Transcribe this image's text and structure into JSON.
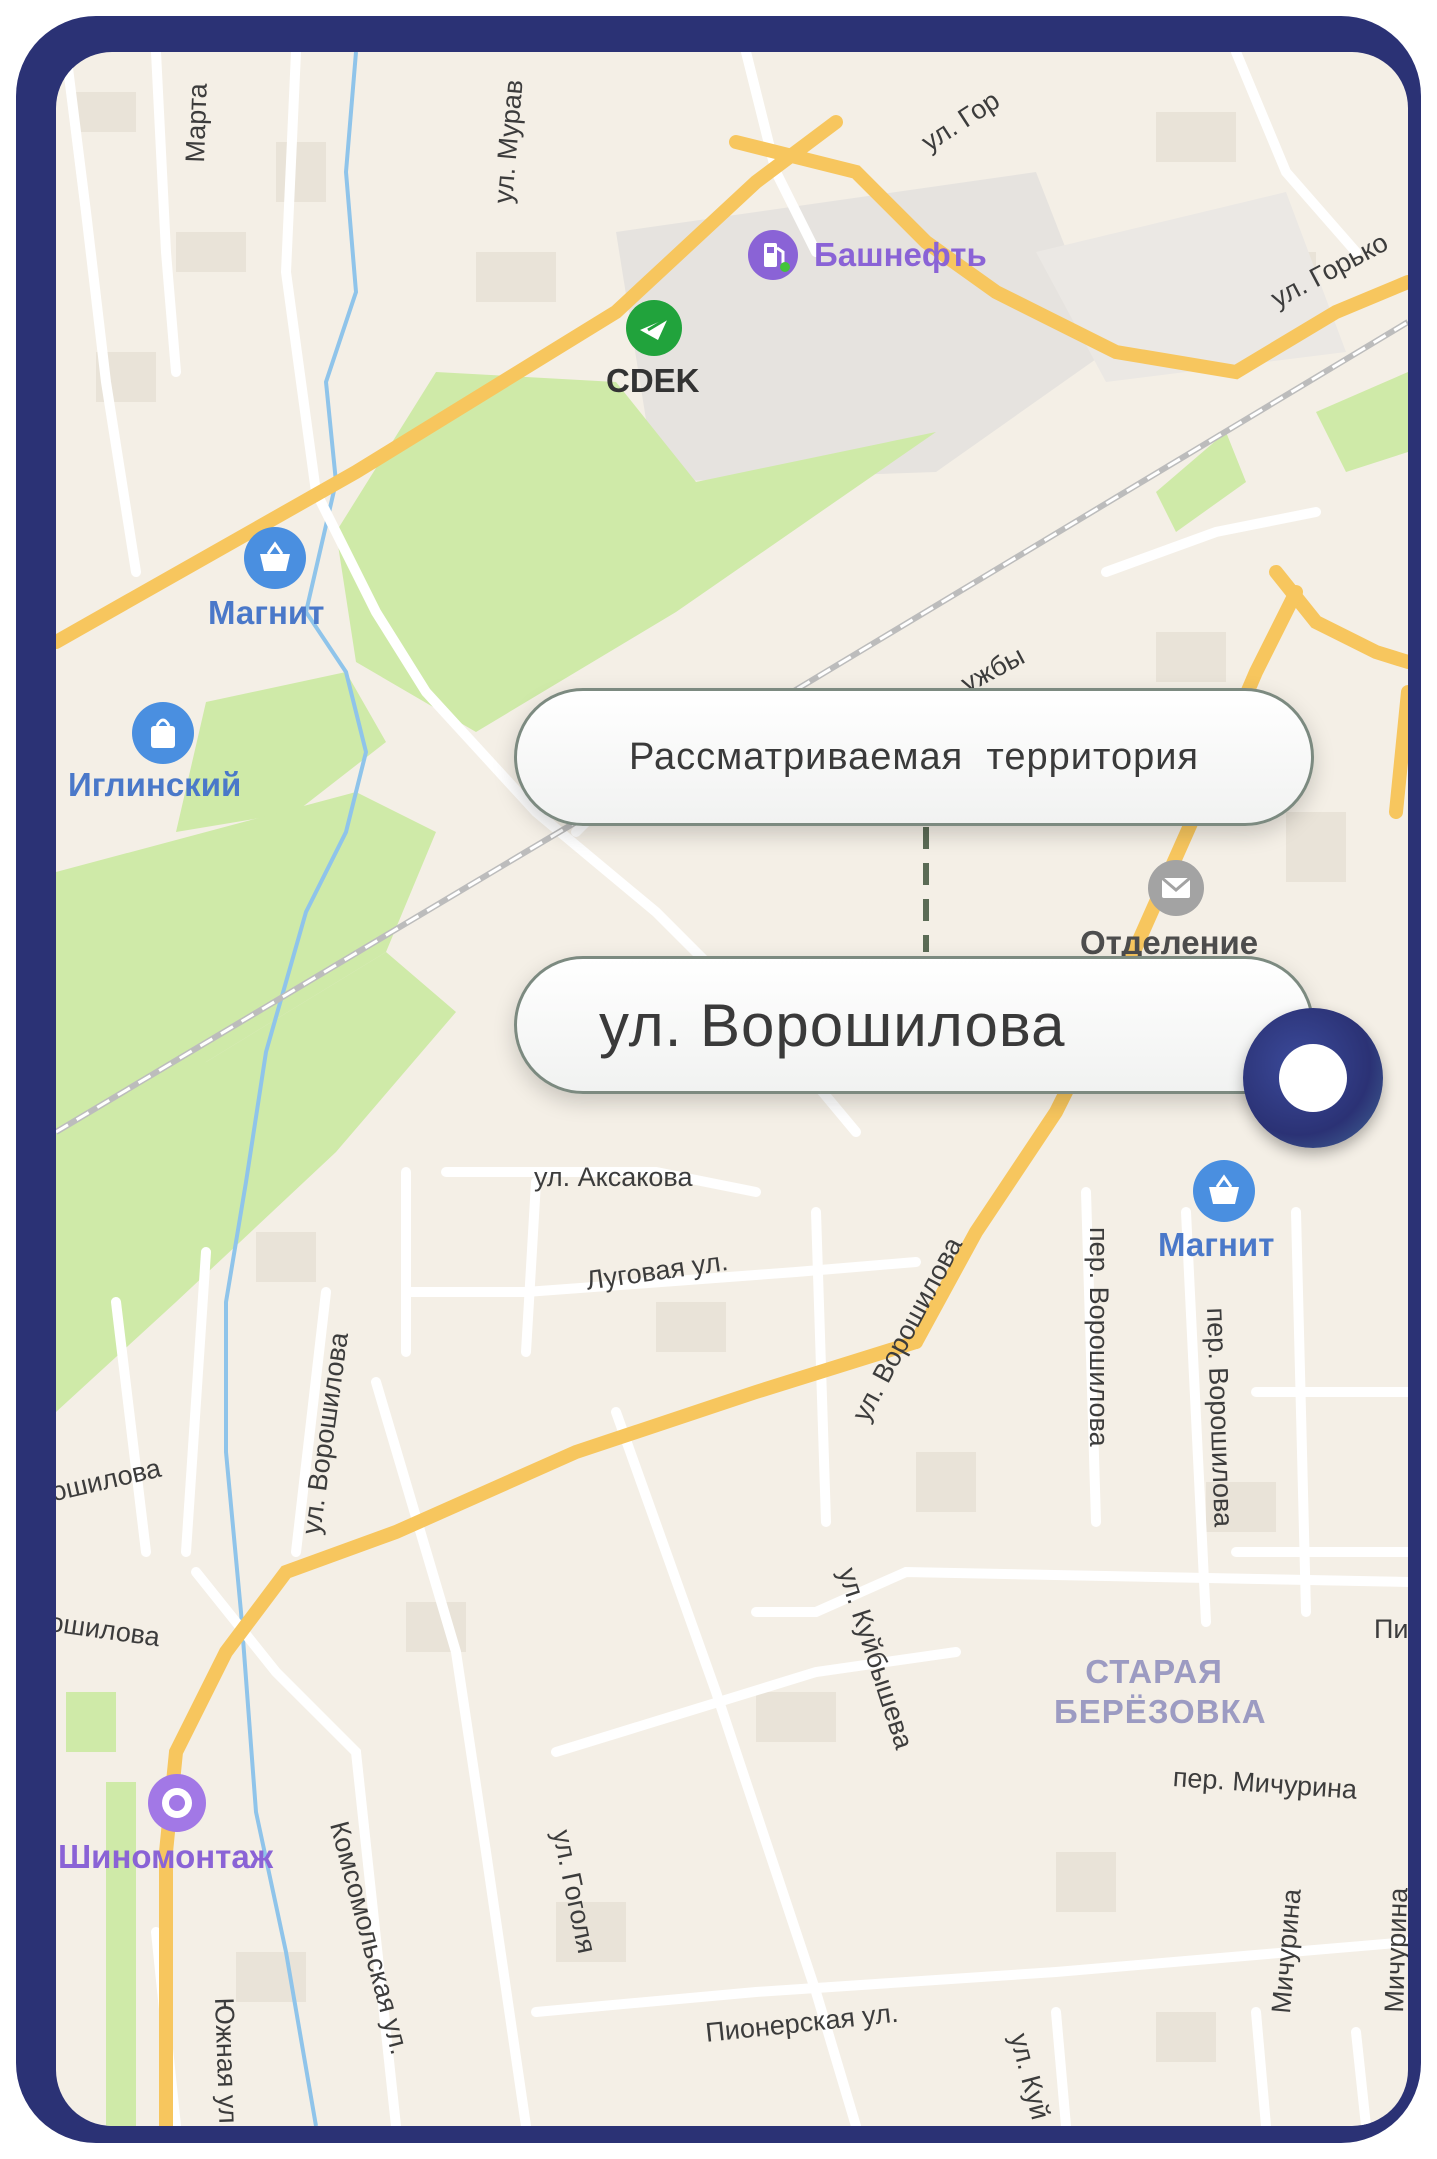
{
  "colors": {
    "frame": "#2b3275",
    "map_bg": "#f4efe6",
    "park": "#cfeaa8",
    "major_road": "#f7c65e",
    "minor_road": "#ffffff",
    "water": "#8fc4ea",
    "railway": "#9a9a9a",
    "poi_blue": "#4a78c9",
    "poi_purple": "#8a63d6",
    "connector": "#5b6b55"
  },
  "callouts": {
    "territory": "Рассматриваемая  территория",
    "street": "ул. Ворошилова"
  },
  "streets": [
    {
      "id": "marta",
      "text": "Марта"
    },
    {
      "id": "murav",
      "text": "ул. Мурав"
    },
    {
      "id": "gork1",
      "text": "ул. Гор"
    },
    {
      "id": "gork2",
      "text": "ул. Горько"
    },
    {
      "id": "druzhby",
      "text": "ужбы"
    },
    {
      "id": "aksakova",
      "text": "ул. Аксакова"
    },
    {
      "id": "lugovaya",
      "text": "Луговая ул."
    },
    {
      "id": "vorosh_main",
      "text": "ул. Ворошилова"
    },
    {
      "id": "vorosh_main2",
      "text": "ул. Ворошилова"
    },
    {
      "id": "per_vorosh1",
      "text": "пер. Ворошилова"
    },
    {
      "id": "per_vorosh2",
      "text": "пер. Ворошилова"
    },
    {
      "id": "vorosh_left",
      "text": "ул. Ворошилова"
    },
    {
      "id": "oshilova",
      "text": "ошилова"
    },
    {
      "id": "oshilova2",
      "text": "ошилова"
    },
    {
      "id": "kuibysheva",
      "text": "ул. Куйбышева"
    },
    {
      "id": "gogolya",
      "text": "ул. Гоголя"
    },
    {
      "id": "komsomol",
      "text": "Комсомольская ул."
    },
    {
      "id": "yuzhnaya",
      "text": "Южная ул"
    },
    {
      "id": "pionerskaya",
      "text": "Пионерская ул."
    },
    {
      "id": "michurina",
      "text": "пер. Мичурина"
    },
    {
      "id": "michurina2",
      "text": "Мичурина"
    },
    {
      "id": "michurina3",
      "text": "Мичурина"
    },
    {
      "id": "kui2",
      "text": "ул. Куй"
    },
    {
      "id": "pi",
      "text": "Пи"
    }
  ],
  "pois": [
    {
      "id": "bashneft",
      "name": "Башнефть",
      "icon": "fuel-icon"
    },
    {
      "id": "cdek",
      "name": "CDEK",
      "icon": "cdek-logo-icon"
    },
    {
      "id": "magnit1",
      "name": "Магнит",
      "icon": "shopping-basket-icon"
    },
    {
      "id": "iglinsky",
      "name": "Иглинский",
      "icon": "shopping-bag-icon"
    },
    {
      "id": "otdelenie",
      "name": "Отделение",
      "icon": "mail-icon"
    },
    {
      "id": "magnit2",
      "name": "Магнит",
      "icon": "shopping-basket-icon"
    },
    {
      "id": "shinomontazh",
      "name": "Шиномонтаж",
      "icon": "tire-icon"
    }
  ],
  "district": {
    "line1": "СТАРАЯ",
    "line2": "БЕРЁЗОВКА"
  }
}
